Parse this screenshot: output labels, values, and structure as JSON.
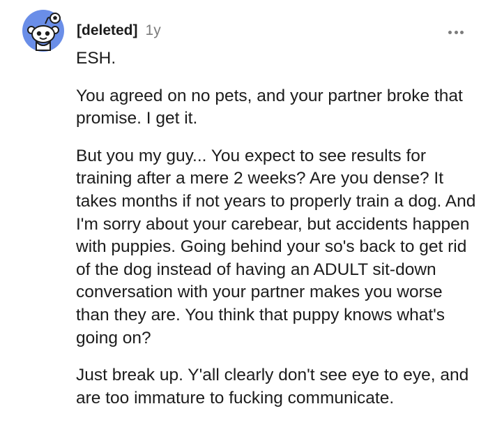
{
  "comment": {
    "author": "[deleted]",
    "age": "1y",
    "avatar_icon": "reddit-snoo-icon",
    "more_icon": "more-options-icon",
    "paragraphs": [
      "ESH.",
      "You agreed on no pets, and your partner broke that promise. I get it.",
      "But you my guy... You expect to see results for training after a mere 2 weeks? Are you dense? It takes months if not years to properly train a dog. And I'm sorry about your carebear, but accidents happen with puppies. Going behind your so's back to get rid of the dog instead of having an ADULT sit-down conversation with your partner makes you worse than they are. You think that puppy knows what's going on?",
      "Just break up. Y'all clearly don't see eye to eye, and are too immature to fucking communicate."
    ]
  },
  "colors": {
    "avatar_bg": "#6a8ee8",
    "text": "#1c1c1c",
    "meta": "#7c7c7c"
  }
}
